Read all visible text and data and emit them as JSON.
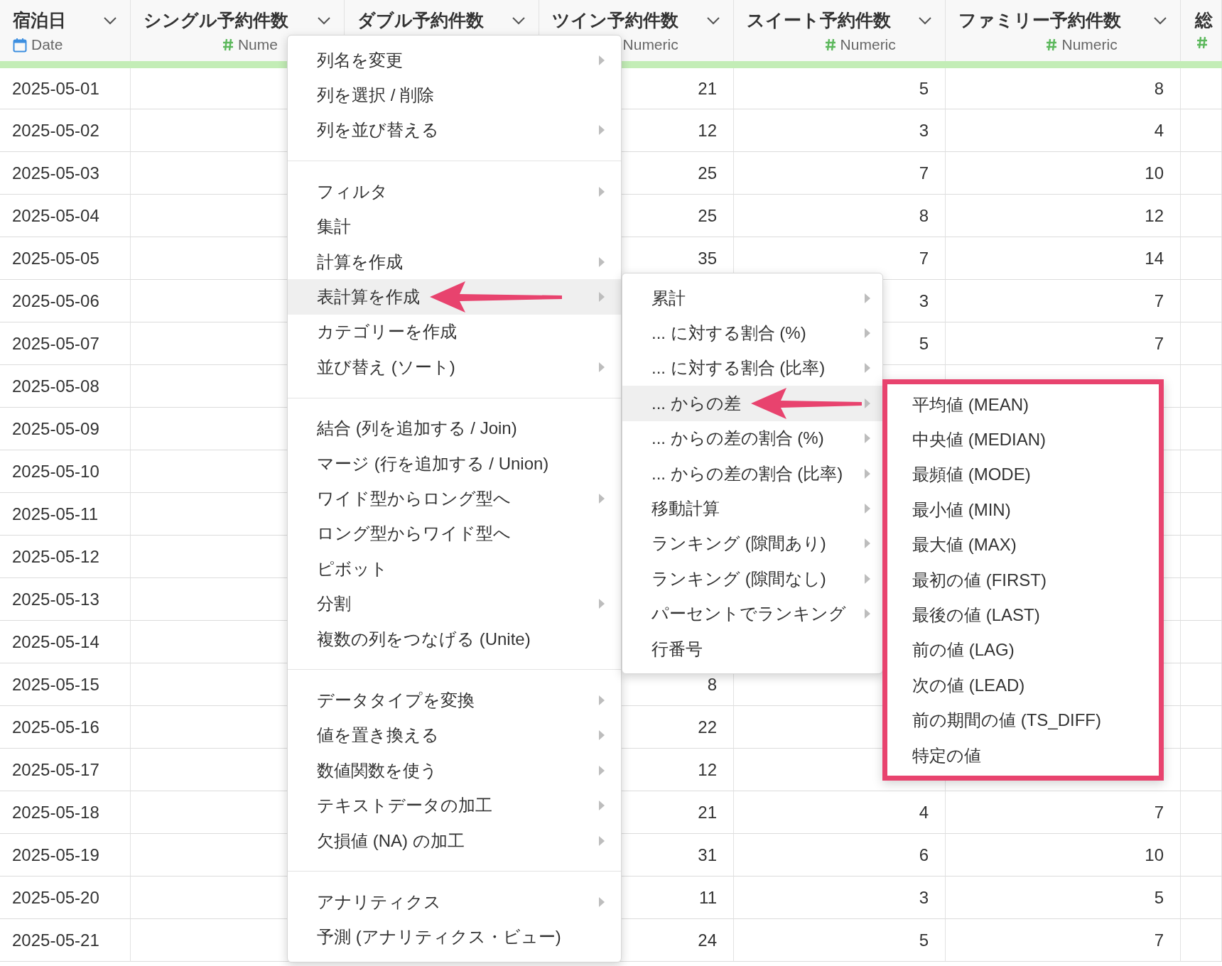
{
  "table": {
    "columns": [
      {
        "name": "宿泊日",
        "kind": "date",
        "type_label": "Date"
      },
      {
        "name": "シングル予約件数",
        "kind": "numeric",
        "type_label": "Nume"
      },
      {
        "name": "ダブル予約件数",
        "kind": "hidden_type"
      },
      {
        "name": "ツイン予約件数",
        "kind": "label_only",
        "type_label": "Numeric"
      },
      {
        "name": "スイート予約件数",
        "kind": "numeric",
        "type_label": "Numeric"
      },
      {
        "name": "ファミリー予約件数",
        "kind": "numeric",
        "type_label": "Numeric"
      },
      {
        "name": "総",
        "kind": "icon_only"
      }
    ],
    "rows": [
      {
        "date": "2025-05-01",
        "twin": "21",
        "suite": "5",
        "family": "8"
      },
      {
        "date": "2025-05-02",
        "twin": "12",
        "suite": "3",
        "family": "4"
      },
      {
        "date": "2025-05-03",
        "twin": "25",
        "suite": "7",
        "family": "10"
      },
      {
        "date": "2025-05-04",
        "twin": "25",
        "suite": "8",
        "family": "12"
      },
      {
        "date": "2025-05-05",
        "twin": "35",
        "suite": "7",
        "family": "14"
      },
      {
        "date": "2025-05-06",
        "suite": "3",
        "family": "7"
      },
      {
        "date": "2025-05-07",
        "suite": "5",
        "family": "7"
      },
      {
        "date": "2025-05-08"
      },
      {
        "date": "2025-05-09"
      },
      {
        "date": "2025-05-10"
      },
      {
        "date": "2025-05-11"
      },
      {
        "date": "2025-05-12"
      },
      {
        "date": "2025-05-13"
      },
      {
        "date": "2025-05-14"
      },
      {
        "date": "2025-05-15",
        "twin": "8"
      },
      {
        "date": "2025-05-16",
        "twin": "22"
      },
      {
        "date": "2025-05-17",
        "twin": "12"
      },
      {
        "date": "2025-05-18",
        "twin": "21",
        "suite": "4",
        "family": "7"
      },
      {
        "date": "2025-05-19",
        "twin": "31",
        "suite": "6",
        "family": "10"
      },
      {
        "date": "2025-05-20",
        "twin": "11",
        "suite": "3",
        "family": "5"
      },
      {
        "date": "2025-05-21",
        "twin": "24",
        "suite": "5",
        "family": "7"
      }
    ]
  },
  "context_menu": {
    "groups": [
      [
        {
          "label": "列名を変更",
          "submenu": true,
          "selected": false
        },
        {
          "label": "列を選択 / 削除",
          "submenu": false,
          "selected": false
        },
        {
          "label": "列を並び替える",
          "submenu": true,
          "selected": false
        }
      ],
      [
        {
          "label": "フィルタ",
          "submenu": true,
          "selected": false
        },
        {
          "label": "集計",
          "submenu": false,
          "selected": false
        },
        {
          "label": "計算を作成",
          "submenu": true,
          "selected": false
        },
        {
          "label": "表計算を作成",
          "submenu": true,
          "selected": true,
          "pointed": true
        },
        {
          "label": "カテゴリーを作成",
          "submenu": false,
          "selected": false
        },
        {
          "label": "並び替え (ソート)",
          "submenu": true,
          "selected": false
        }
      ],
      [
        {
          "label": "結合 (列を追加する / Join)",
          "submenu": false,
          "selected": false
        },
        {
          "label": "マージ (行を追加する / Union)",
          "submenu": false,
          "selected": false
        },
        {
          "label": "ワイド型からロング型へ",
          "submenu": true,
          "selected": false
        },
        {
          "label": "ロング型からワイド型へ",
          "submenu": false,
          "selected": false
        },
        {
          "label": "ピボット",
          "submenu": false,
          "selected": false
        },
        {
          "label": "分割",
          "submenu": true,
          "selected": false
        },
        {
          "label": "複数の列をつなげる (Unite)",
          "submenu": false,
          "selected": false
        }
      ],
      [
        {
          "label": "データタイプを変換",
          "submenu": true,
          "selected": false
        },
        {
          "label": "値を置き換える",
          "submenu": true,
          "selected": false
        },
        {
          "label": "数値関数を使う",
          "submenu": true,
          "selected": false
        },
        {
          "label": "テキストデータの加工",
          "submenu": true,
          "selected": false
        },
        {
          "label": "欠損値 (NA) の加工",
          "submenu": true,
          "selected": false
        }
      ],
      [
        {
          "label": "アナリティクス",
          "submenu": true,
          "selected": false
        },
        {
          "label": "予測 (アナリティクス・ビュー)",
          "submenu": false,
          "selected": false
        }
      ]
    ]
  },
  "table_calc_submenu": {
    "items": [
      {
        "label": "累計",
        "submenu": true,
        "selected": false
      },
      {
        "label": "... に対する割合 (%)",
        "submenu": true,
        "selected": false
      },
      {
        "label": "... に対する割合 (比率)",
        "submenu": true,
        "selected": false
      },
      {
        "label": "... からの差",
        "submenu": true,
        "selected": true,
        "pointed": true
      },
      {
        "label": "... からの差の割合 (%)",
        "submenu": true,
        "selected": false
      },
      {
        "label": "... からの差の割合 (比率)",
        "submenu": true,
        "selected": false
      },
      {
        "label": "移動計算",
        "submenu": true,
        "selected": false
      },
      {
        "label": "ランキング (隙間あり)",
        "submenu": true,
        "selected": false
      },
      {
        "label": "ランキング (隙間なし)",
        "submenu": true,
        "selected": false
      },
      {
        "label": "パーセントでランキング",
        "submenu": true,
        "selected": false
      },
      {
        "label": "行番号",
        "submenu": false,
        "selected": false
      }
    ]
  },
  "difference_submenu": {
    "outlined": true,
    "items": [
      {
        "label": "平均値 (MEAN)",
        "selected": false
      },
      {
        "label": "中央値 (MEDIAN)",
        "selected": false
      },
      {
        "label": "最頻値 (MODE)",
        "selected": false
      },
      {
        "label": "最小値 (MIN)",
        "selected": false
      },
      {
        "label": "最大値 (MAX)",
        "selected": false
      },
      {
        "label": "最初の値 (FIRST)",
        "selected": false
      },
      {
        "label": "最後の値 (LAST)",
        "selected": false
      },
      {
        "label": "前の値 (LAG)",
        "selected": false
      },
      {
        "label": "次の値 (LEAD)",
        "selected": false
      },
      {
        "label": "前の期間の値 (TS_DIFF)",
        "selected": false
      },
      {
        "label": "特定の値",
        "selected": false
      }
    ]
  }
}
